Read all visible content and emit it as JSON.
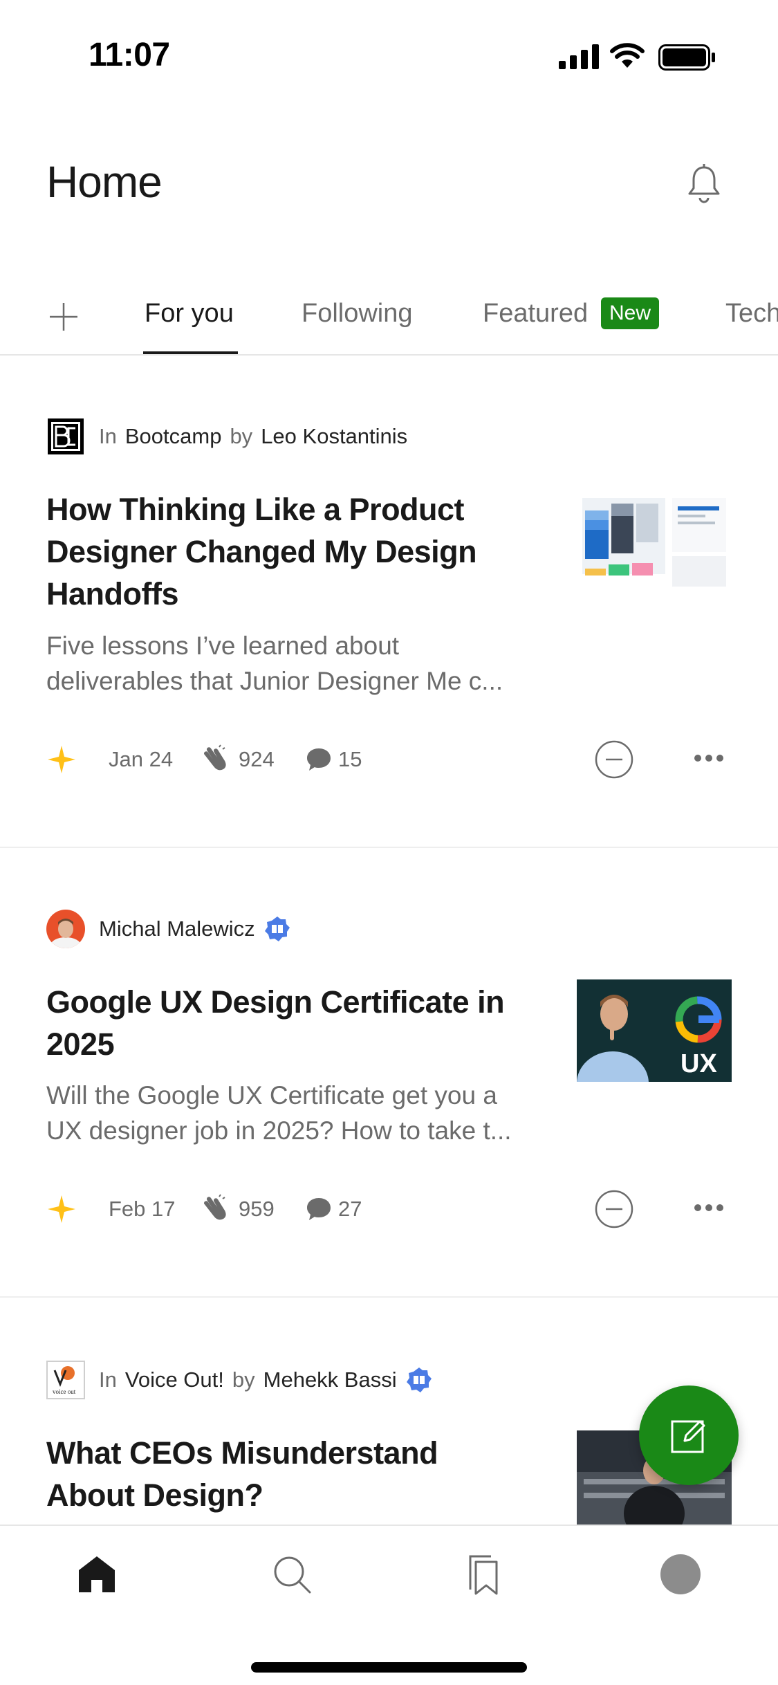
{
  "status_bar": {
    "time": "11:07"
  },
  "header": {
    "title": "Home"
  },
  "tabs": [
    {
      "label": "For you",
      "active": true
    },
    {
      "label": "Following",
      "active": false
    },
    {
      "label": "Featured",
      "badge": "New",
      "active": false
    },
    {
      "label": "Tech",
      "active": false
    }
  ],
  "articles": [
    {
      "in_label": "In",
      "publication": "Bootcamp",
      "by_label": "by",
      "author": "Leo Kostantinis",
      "title": "How Thinking Like a Product Designer Changed My Design Handoffs",
      "subtitle": "Five lessons I’ve learned about deliverables that Junior Designer Me c...",
      "date": "Jan 24",
      "claps": "924",
      "comments": "15"
    },
    {
      "author": "Michal Malewicz",
      "title": "Google UX Design Certificate in 2025",
      "subtitle": "Will the Google UX Certificate get you a UX designer job in 2025? How to take t...",
      "date": "Feb 17",
      "claps": "959",
      "comments": "27",
      "thumb_text": "UX"
    },
    {
      "in_label": "In",
      "publication": "Voice Out!",
      "by_label": "by",
      "author": "Mehekk Bassi",
      "title": "What CEOs Misunderstand About Design?",
      "pub_logo_text": "voice out"
    }
  ],
  "colors": {
    "accent": "#1a8917",
    "star": "#ffc017",
    "verified": "#4b7be5",
    "text": "#191919",
    "muted": "#6b6b6b"
  },
  "icons": [
    "bell-icon",
    "plus-icon",
    "star-icon",
    "clap-icon",
    "comment-icon",
    "show-less-icon",
    "more-icon",
    "edit-icon",
    "home-icon",
    "search-icon",
    "library-icon",
    "profile-icon"
  ]
}
